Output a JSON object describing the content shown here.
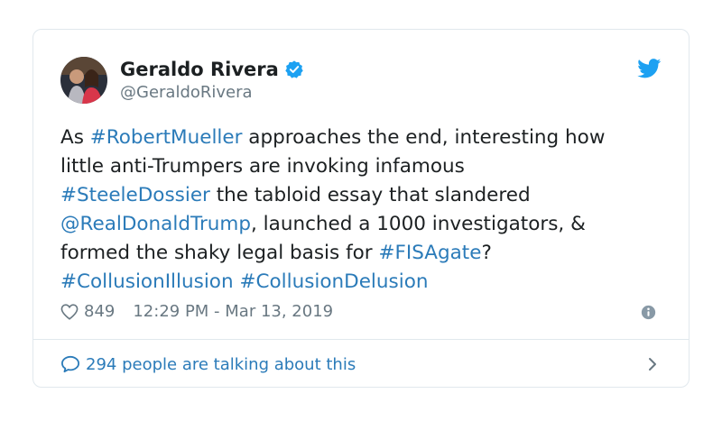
{
  "author": {
    "display_name": "Geraldo Rivera",
    "handle": "@GeraldoRivera",
    "verified": true
  },
  "tweet": {
    "lines": [
      [
        {
          "t": "As ",
          "link": false
        },
        {
          "t": "#RobertMueller",
          "link": true
        },
        {
          "t": " approaches the end, interesting how",
          "link": false
        }
      ],
      [
        {
          "t": "little anti-Trumpers are invoking infamous",
          "link": false
        }
      ],
      [
        {
          "t": "#SteeleDossier",
          "link": true
        },
        {
          "t": " the tabloid essay that slandered",
          "link": false
        }
      ],
      [
        {
          "t": "@RealDonaldTrump",
          "link": true
        },
        {
          "t": ", launched a 1000 investigators, &",
          "link": false
        }
      ],
      [
        {
          "t": "formed the shaky legal basis for ",
          "link": false
        },
        {
          "t": "#FISAgate",
          "link": true
        },
        {
          "t": "?",
          "link": false
        }
      ],
      [
        {
          "t": "#CollusionIllusion",
          "link": true
        },
        {
          "t": " ",
          "link": false
        },
        {
          "t": "#CollusionDelusion",
          "link": true
        }
      ]
    ]
  },
  "meta": {
    "likes": "849",
    "timestamp": "12:29 PM - Mar 13, 2019"
  },
  "footer": {
    "talking_text": "294 people are talking about this"
  },
  "colors": {
    "link": "#2b7bb9",
    "verified": "#1da1f2",
    "twitter_brand": "#1da1f2",
    "muted": "#697882",
    "border": "#e1e8ed"
  },
  "icons": {
    "brand": "twitter-bird-icon",
    "verified": "verified-badge-icon",
    "like": "heart-icon",
    "info": "info-icon",
    "reply": "speech-bubble-icon",
    "chevron": "chevron-right-icon"
  }
}
